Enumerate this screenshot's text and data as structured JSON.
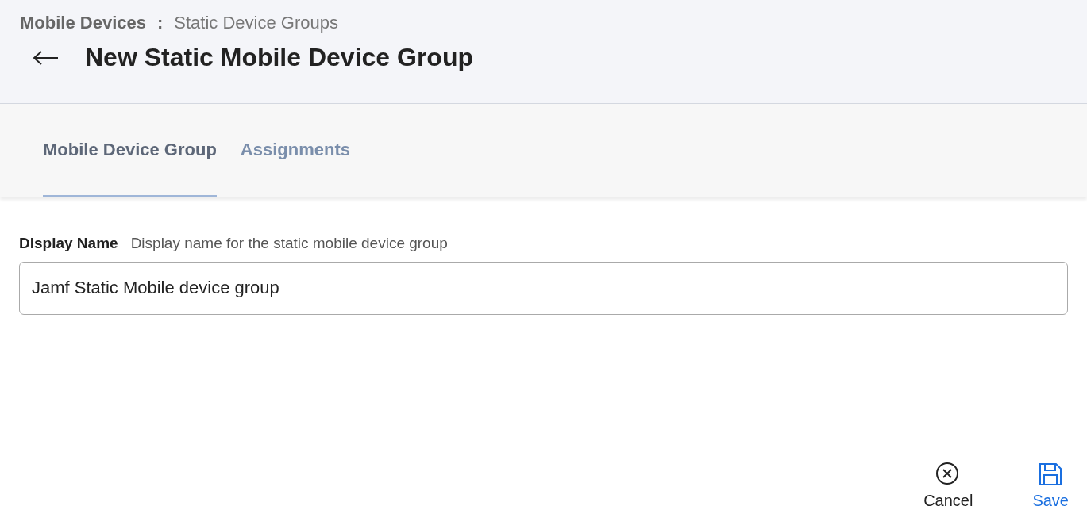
{
  "breadcrumb": {
    "parent": "Mobile Devices",
    "separator": ":",
    "current": "Static Device Groups"
  },
  "page_title": "New Static Mobile Device Group",
  "tabs": [
    {
      "label": "Mobile Device Group",
      "selected": true
    },
    {
      "label": "Assignments",
      "selected": false
    }
  ],
  "field": {
    "label": "Display Name",
    "hint": "Display name for the static mobile device group",
    "value": "Jamf Static Mobile device group"
  },
  "actions": [
    {
      "kind": "cancel",
      "label": "Cancel"
    },
    {
      "kind": "save",
      "label": "Save"
    }
  ]
}
